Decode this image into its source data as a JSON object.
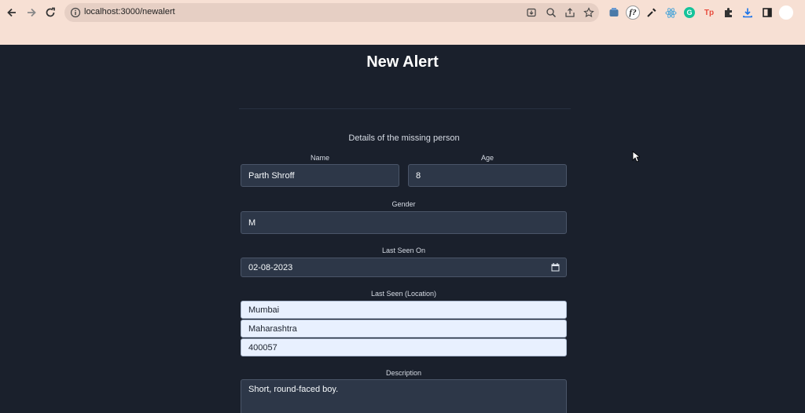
{
  "browser": {
    "url": "localhost:3000/newalert"
  },
  "page": {
    "title": "New Alert",
    "subtitle": "Details of the missing person"
  },
  "form": {
    "name": {
      "label": "Name",
      "value": "Parth Shroff"
    },
    "age": {
      "label": "Age",
      "value": "8"
    },
    "gender": {
      "label": "Gender",
      "value": "M"
    },
    "last_seen_on": {
      "label": "Last Seen On",
      "value": "02-08-2023"
    },
    "location": {
      "label": "Last Seen (Location)",
      "city": "Mumbai",
      "state": "Maharashtra",
      "pincode": "400057"
    },
    "description": {
      "label": "Description",
      "value": "Short, round-faced boy."
    }
  },
  "colors": {
    "page_background": "#1a202c",
    "input_background": "#2d3748",
    "autofill_background": "#e8f0fe",
    "chrome_background": "#f7e0d4"
  }
}
